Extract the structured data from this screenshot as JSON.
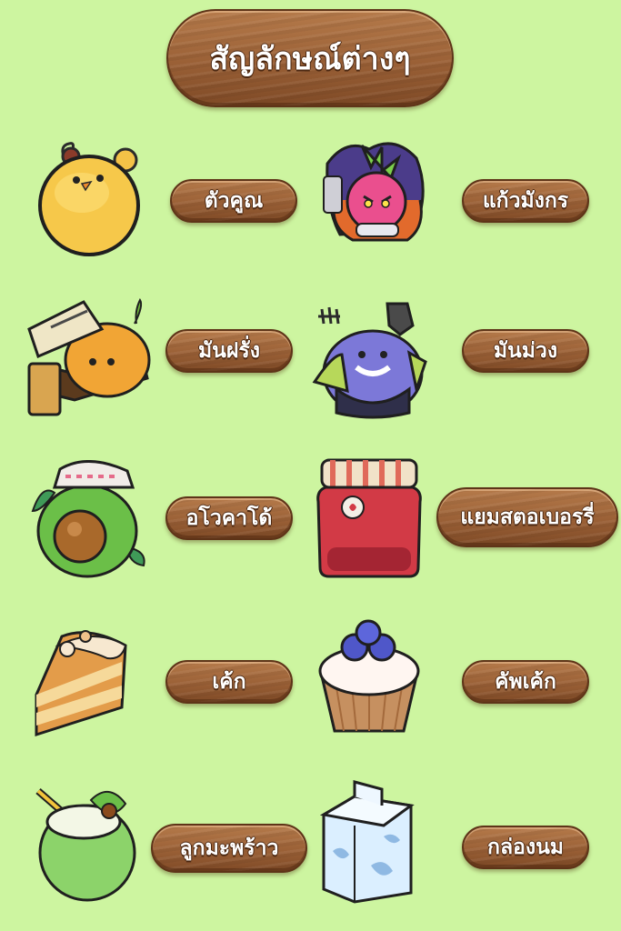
{
  "title": "สัญลักษณ์ต่างๆ",
  "items": [
    {
      "label": "ตัวคูณ",
      "icon": "yellow-chick-icon"
    },
    {
      "label": "แก้วมังกร",
      "icon": "dragon-fruit-icon"
    },
    {
      "label": "มันฝรั่ง",
      "icon": "potato-icon"
    },
    {
      "label": "มันม่วง",
      "icon": "purple-yam-icon"
    },
    {
      "label": "อโวคาโด้",
      "icon": "avocado-icon"
    },
    {
      "label": "แยมสตอเบอรรี่",
      "icon": "strawberry-jam-icon"
    },
    {
      "label": "เค้ก",
      "icon": "cake-slice-icon"
    },
    {
      "label": "คัพเค้ก",
      "icon": "cupcake-icon"
    },
    {
      "label": "ลูกมะพร้าว",
      "icon": "coconut-icon"
    },
    {
      "label": "กล่องนม",
      "icon": "milk-carton-icon"
    }
  ]
}
